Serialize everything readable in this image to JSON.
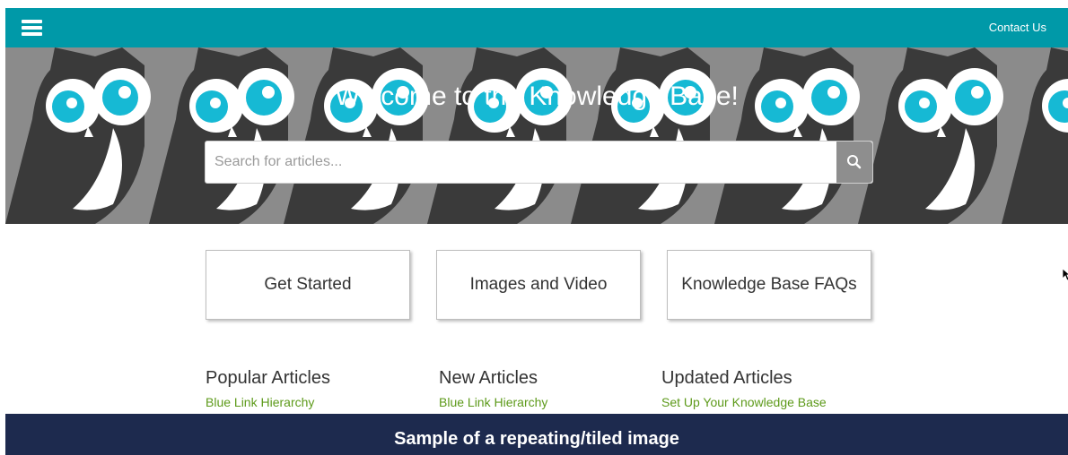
{
  "topbar": {
    "contact_label": "Contact Us"
  },
  "hero": {
    "title": "Welcome to the Knowledge Base!",
    "search_placeholder": "Search for articles..."
  },
  "cards": [
    {
      "label": "Get Started"
    },
    {
      "label": "Images and Video"
    },
    {
      "label": "Knowledge Base FAQs"
    }
  ],
  "columns": [
    {
      "heading": "Popular Articles",
      "links": [
        "Blue Link Hierarchy"
      ]
    },
    {
      "heading": "New Articles",
      "links": [
        "Blue Link Hierarchy"
      ]
    },
    {
      "heading": "Updated Articles",
      "links": [
        "Set Up Your Knowledge Base"
      ]
    }
  ],
  "caption": "Sample of a repeating/tiled image",
  "colors": {
    "topbar": "#0099a8",
    "hero_background": "#8b8b8b",
    "owl_body": "#3a3a3a",
    "owl_eye": "#16b9d4",
    "link": "#5d9a1a",
    "caption_bg": "#1d2a4e"
  }
}
